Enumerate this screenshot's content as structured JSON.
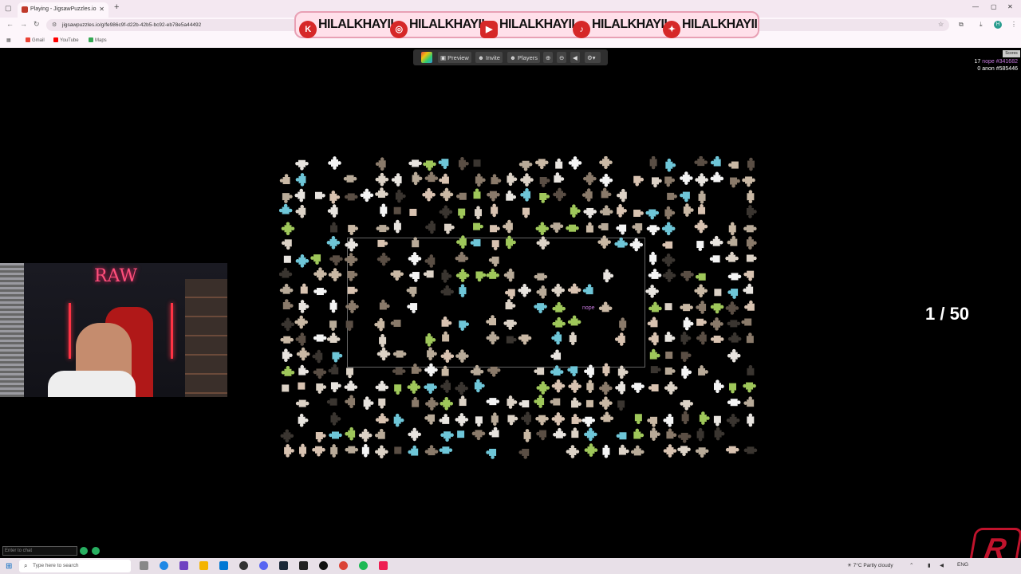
{
  "browser": {
    "tab_title": "Playing - JigsawPuzzles.io",
    "url": "jigsawpuzzles.io/g/fe986c9f-d22b-42b5-bc92-eb78e5a44492",
    "bookmarks": [
      "Gmail",
      "YouTube",
      "Maps"
    ],
    "profile_initial": "H"
  },
  "overlay_banner": {
    "handles": [
      "HILALKHAYII",
      "HILALKHAYII",
      "HILALKHAYII",
      "HILALKHAYII",
      "HILALKHAYII"
    ]
  },
  "game_toolbar": {
    "preview": "Preview",
    "invite": "Invite",
    "players": "Players"
  },
  "scoreboard": {
    "label": "Scores",
    "rows": [
      {
        "score": "17",
        "player": "nope #341682"
      },
      {
        "score": "0",
        "player": "anon #585446"
      }
    ]
  },
  "progress": {
    "text": "1 / 50",
    "placed": 1,
    "total": 50
  },
  "cursor_label": "nope",
  "webcam": {
    "sign": "RAW"
  },
  "chat": {
    "placeholder": "Enter to chat"
  },
  "taskbar": {
    "search_placeholder": "Type here to search",
    "weather": "7°C  Partly cloudy",
    "language": "ENG"
  },
  "colors": {
    "background": "#000000",
    "toolbar": "#2f2f2f",
    "accent_purple": "#c678dd",
    "brand_red": "#c0132c"
  }
}
